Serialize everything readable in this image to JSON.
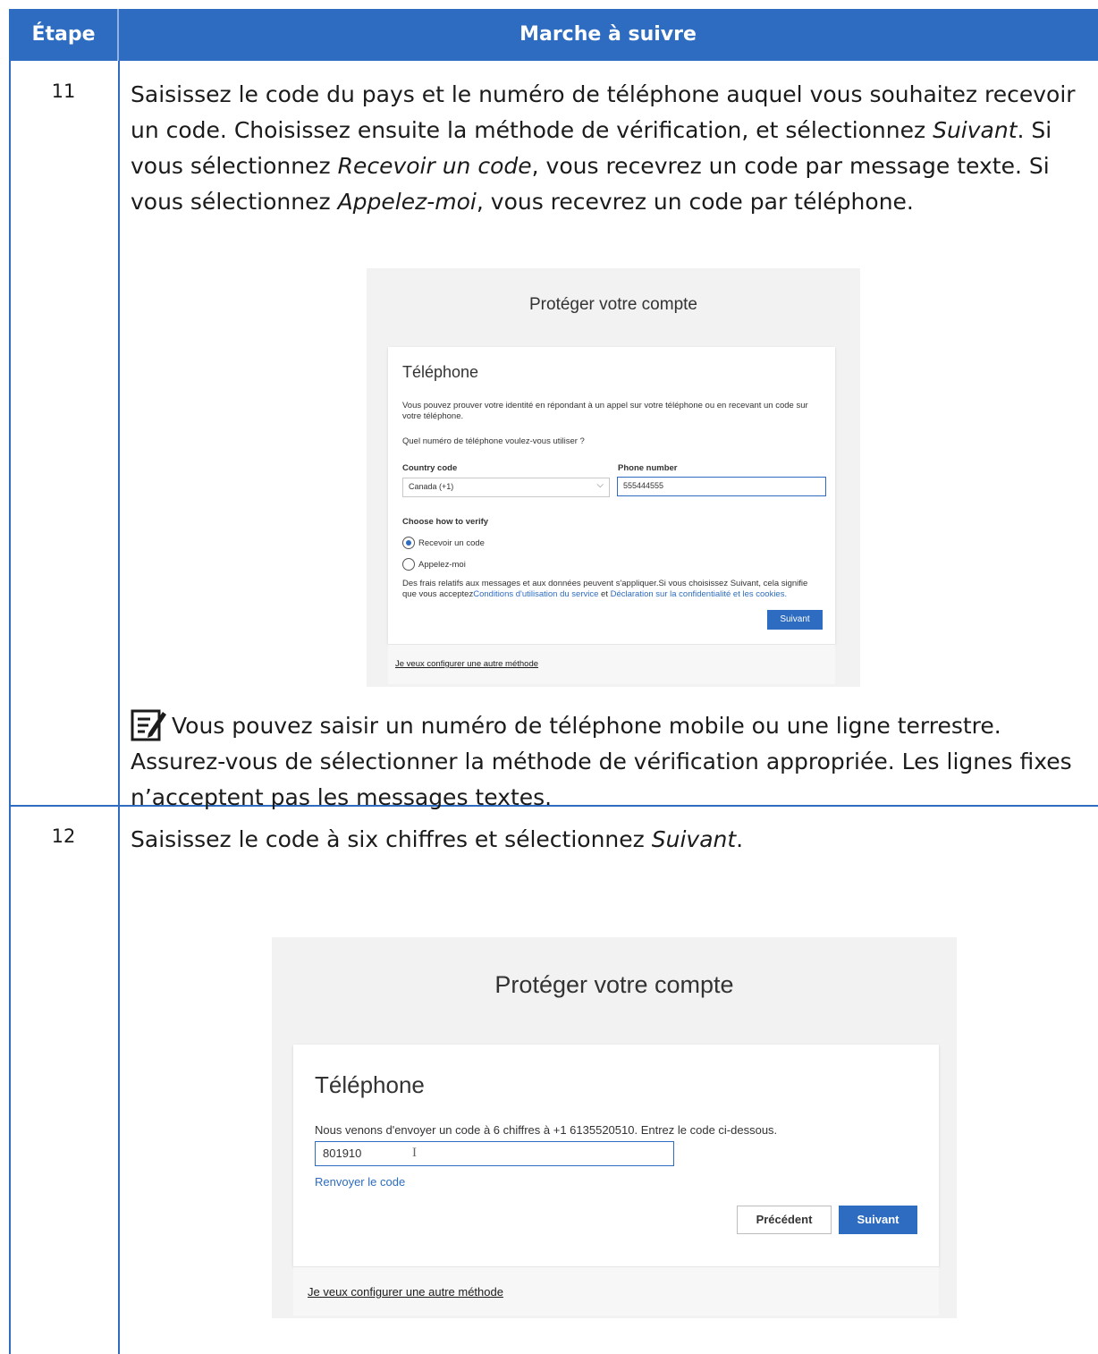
{
  "table": {
    "headers": {
      "step": "Étape",
      "action": "Marche à suivre"
    }
  },
  "step11": {
    "number": "11",
    "text_parts": {
      "p1": "Saisissez le code du pays et le numéro de téléphone auquel vous souhaitez recevoir un code. Choisissez ensuite la méthode de vérification, et sélectionnez ",
      "i1": "Suivant",
      "p2": ". Si vous sélectionnez ",
      "i2": "Recevoir un code",
      "p3": ", vous recevrez un code par message texte. Si vous sélectionnez ",
      "i3": "Appelez-moi",
      "p4": ", vous recevrez un code par téléphone."
    },
    "screenshot": {
      "title": "Protéger votre compte",
      "card_heading": "Téléphone",
      "description": "Vous pouvez prouver votre identité en répondant à un appel sur votre téléphone ou en recevant un code sur votre téléphone.",
      "question": "Quel numéro de téléphone voulez-vous utiliser ?",
      "country_label": "Country code",
      "country_value": "Canada (+1)",
      "phone_label": "Phone number",
      "phone_value": "555444555",
      "verify_label": "Choose how to verify",
      "option_code": "Recevoir un code",
      "option_call": "Appelez-moi",
      "legal_1": "Des frais relatifs aux messages et aux données peuvent s'appliquer.Si vous choisissez Suivant, cela signifie que vous acceptez",
      "legal_link1": "Conditions d'utilisation du service",
      "legal_and": " et ",
      "legal_link2": "Déclaration sur la confidentialité et les cookies.",
      "next_button": "Suivant",
      "footer_link": "Je veux configurer une autre méthode"
    },
    "note": "Vous pouvez saisir un numéro de téléphone mobile ou une ligne terrestre. Assurez-vous de sélectionner la méthode de vérification appropriée. Les lignes fixes n’acceptent pas les messages textes."
  },
  "step12": {
    "number": "12",
    "text_parts": {
      "p1": "Saisissez le code à six chiffres et sélectionnez ",
      "i1": "Suivant",
      "p2": "."
    },
    "screenshot": {
      "title": "Protéger votre compte",
      "card_heading": "Téléphone",
      "message": "Nous venons d'envoyer un code à 6 chiffres à +1 6135520510. Entrez le code ci-dessous.",
      "code_value": "801910",
      "resend_link": "Renvoyer le code",
      "prev_button": "Précédent",
      "next_button": "Suivant",
      "footer_link": "Je veux configurer une autre méthode"
    }
  },
  "colors": {
    "accent": "#2d6cc0",
    "header_text": "#ffffff"
  },
  "icons": {
    "note": "note-edit-icon"
  }
}
